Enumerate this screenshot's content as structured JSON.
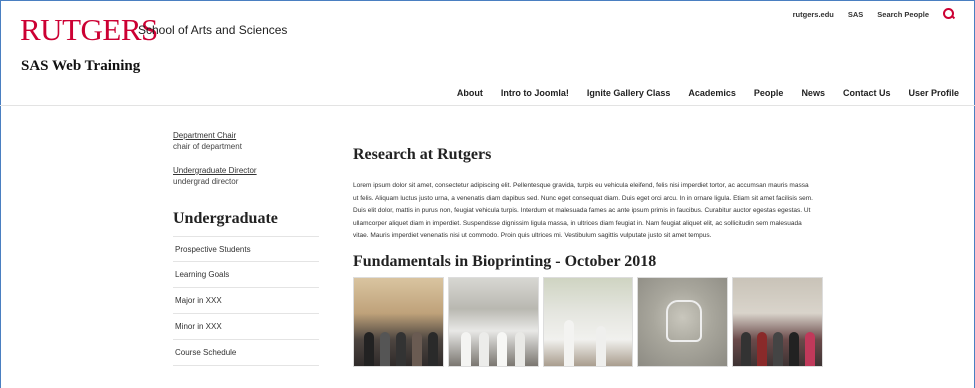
{
  "header": {
    "logo": "RUTGERS",
    "school": "School of Arts and Sciences",
    "site_title": "SAS Web Training",
    "utility_links": [
      "rutgers.edu",
      "SAS",
      "Search People"
    ]
  },
  "nav": [
    "About",
    "Intro to Joomla!",
    "Ignite Gallery Class",
    "Academics",
    "People",
    "News",
    "Contact Us",
    "User Profile"
  ],
  "sidebar": {
    "contacts": [
      {
        "role": "Department Chair",
        "person": "chair of department"
      },
      {
        "role": "Undergraduate Director",
        "person": "undergrad director"
      }
    ],
    "section_title": "Undergraduate",
    "items": [
      "Prospective Students",
      "Learning Goals",
      "Major in XXX",
      "Minor in XXX",
      "Course Schedule"
    ]
  },
  "main": {
    "heading": "Research at Rutgers",
    "body": "Lorem ipsum dolor sit amet, consectetur adipiscing elit. Pellentesque gravida, turpis eu vehicula eleifend, felis nisi imperdiet tortor, ac accumsan mauris massa ut felis. Aliquam luctus justo urna, a venenatis diam dapibus sed. Nunc eget consequat diam. Duis eget orci arcu. In in ornare ligula. Etiam sit amet facilisis sem. Duis elit dolor, mattis in purus non, feugiat vehicula turpis. Interdum et malesuada fames ac ante ipsum primis in faucibus. Curabitur auctor egestas egestas. Ut ullamcorper aliquet diam in imperdiet. Suspendisse dignissim ligula massa, in ultrices diam feugiat in. Nam feugiat aliquet elit, ac sollicitudin sem malesuada vitae. Mauris imperdiet venenatis nisi ut commodo. Proin quis ultrices mi. Vestibulum sagittis vulputate justo sit amet tempus.",
    "gallery_title": "Fundamentals in Bioprinting - October 2018"
  },
  "colors": {
    "brand_red": "#cc0033",
    "frame_blue": "#4a7fc1"
  },
  "icons": {
    "search": "search-icon"
  }
}
